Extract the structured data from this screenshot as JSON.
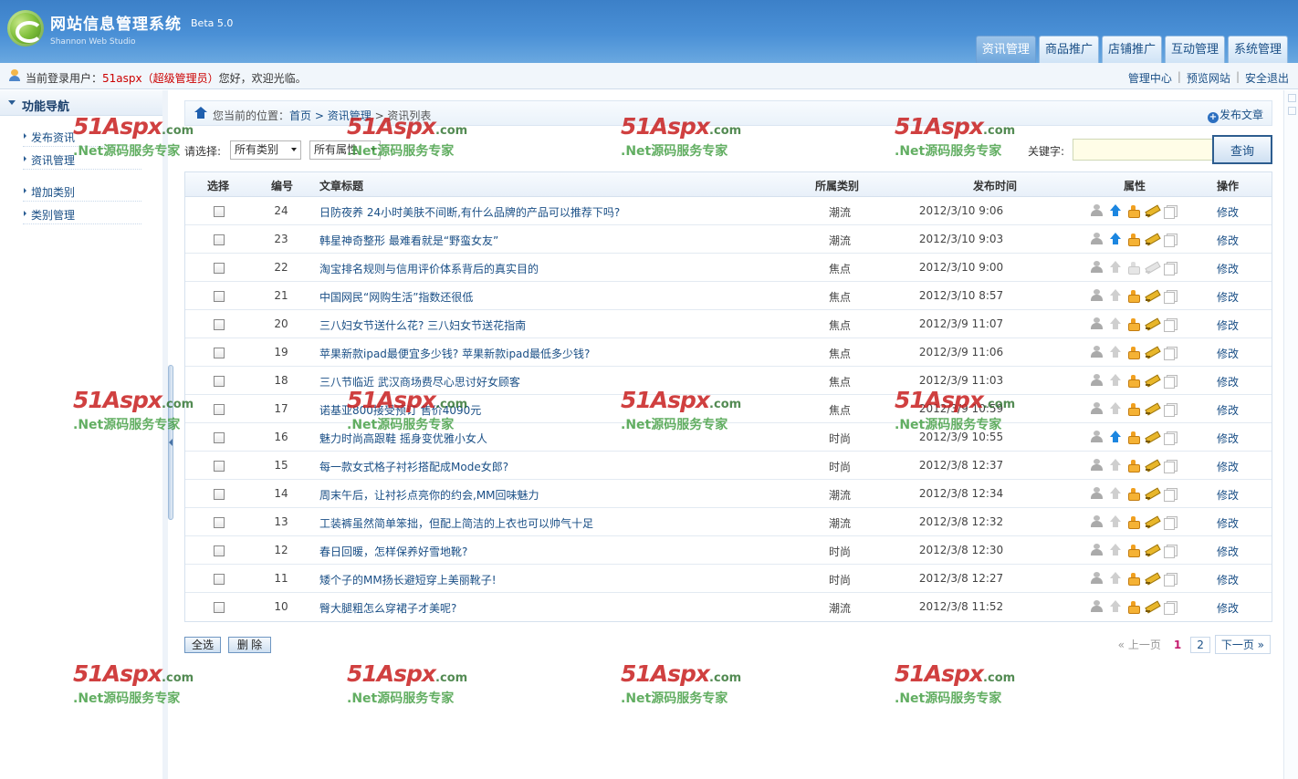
{
  "app": {
    "title": "网站信息管理系统",
    "beta": "Beta 5.0",
    "studio": "Shannon Web Studio"
  },
  "top_tabs": [
    {
      "label": "资讯管理",
      "active": true
    },
    {
      "label": "商品推广",
      "active": false
    },
    {
      "label": "店铺推广",
      "active": false
    },
    {
      "label": "互动管理",
      "active": false
    },
    {
      "label": "系统管理",
      "active": false
    }
  ],
  "userbar": {
    "prefix": "当前登录用户：",
    "username": "51aspx（超级管理员）",
    "welcome": "您好，欢迎光临。",
    "links": [
      "管理中心",
      "预览网站",
      "安全退出"
    ],
    "sep": "|"
  },
  "sidebar": {
    "title": "功能导航",
    "items": [
      "发布资讯",
      "资讯管理",
      "增加类别",
      "类别管理"
    ]
  },
  "breadcrumb": {
    "prefix": "您当前的位置：",
    "items": [
      "首页",
      "> 资讯管理",
      "> 资讯列表"
    ],
    "publish": "发布文章"
  },
  "filter": {
    "label": "请选择:",
    "category": "所有类别",
    "attribute": "所有属性",
    "keyword_label": "关键字:",
    "keyword_value": "",
    "search": "查询"
  },
  "table": {
    "headers": [
      "选择",
      "编号",
      "文章标题",
      "所属类别",
      "发布时间",
      "属性",
      "操作"
    ],
    "op_label": "修改",
    "rows": [
      {
        "id": "24",
        "title": "日防夜养 24小时美肤不间断,有什么品牌的产品可以推荐下吗?",
        "cat": "潮流",
        "time": "2012/3/10 9:06",
        "top": true,
        "thumb": true,
        "pen": true
      },
      {
        "id": "23",
        "title": "韩星神奇整形 最难看就是“野蛮女友”",
        "cat": "潮流",
        "time": "2012/3/10 9:03",
        "top": true,
        "thumb": true,
        "pen": true
      },
      {
        "id": "22",
        "title": "淘宝排名规则与信用评价体系背后的真实目的",
        "cat": "焦点",
        "time": "2012/3/10 9:00",
        "top": false,
        "thumb": false,
        "pen": false
      },
      {
        "id": "21",
        "title": "中国网民“网购生活”指数还很低",
        "cat": "焦点",
        "time": "2012/3/10 8:57",
        "top": false,
        "thumb": true,
        "pen": true
      },
      {
        "id": "20",
        "title": "三八妇女节送什么花? 三八妇女节送花指南",
        "cat": "焦点",
        "time": "2012/3/9 11:07",
        "top": false,
        "thumb": true,
        "pen": true
      },
      {
        "id": "19",
        "title": "苹果新款ipad最便宜多少钱? 苹果新款ipad最低多少钱?",
        "cat": "焦点",
        "time": "2012/3/9 11:06",
        "top": false,
        "thumb": true,
        "pen": true
      },
      {
        "id": "18",
        "title": "三八节临近 武汉商场费尽心思讨好女顾客",
        "cat": "焦点",
        "time": "2012/3/9 11:03",
        "top": false,
        "thumb": true,
        "pen": true
      },
      {
        "id": "17",
        "title": "诺基亚800接受预订 售价4090元",
        "cat": "焦点",
        "time": "2012/3/9 10:59",
        "top": false,
        "thumb": true,
        "pen": true
      },
      {
        "id": "16",
        "title": "魅力时尚高跟鞋 摇身变优雅小女人",
        "cat": "时尚",
        "time": "2012/3/9 10:55",
        "top": true,
        "thumb": true,
        "pen": true
      },
      {
        "id": "15",
        "title": "每一款女式格子衬衫搭配成Mode女郎?",
        "cat": "时尚",
        "time": "2012/3/8 12:37",
        "top": false,
        "thumb": true,
        "pen": true
      },
      {
        "id": "14",
        "title": "周末午后，让衬衫点亮你的约会,MM回味魅力",
        "cat": "潮流",
        "time": "2012/3/8 12:34",
        "top": false,
        "thumb": true,
        "pen": true
      },
      {
        "id": "13",
        "title": "工装裤虽然简单笨拙，但配上简洁的上衣也可以帅气十足",
        "cat": "潮流",
        "time": "2012/3/8 12:32",
        "top": false,
        "thumb": true,
        "pen": true
      },
      {
        "id": "12",
        "title": "春日回暖，怎样保养好雪地靴?",
        "cat": "时尚",
        "time": "2012/3/8 12:30",
        "top": false,
        "thumb": true,
        "pen": true
      },
      {
        "id": "11",
        "title": "矮个子的MM扬长避短穿上美丽靴子!",
        "cat": "时尚",
        "time": "2012/3/8 12:27",
        "top": false,
        "thumb": true,
        "pen": true
      },
      {
        "id": "10",
        "title": "臀大腿粗怎么穿裙子才美呢?",
        "cat": "潮流",
        "time": "2012/3/8 11:52",
        "top": false,
        "thumb": true,
        "pen": true
      }
    ]
  },
  "actions": {
    "select_all": "全选",
    "delete": "删 除"
  },
  "pager": {
    "prev": "« 上一页",
    "current": "1",
    "pages": [
      "2"
    ],
    "next": "下一页 »"
  },
  "watermark": {
    "brand": "51Aspx",
    "domain": ".com",
    "slogan": ".Net源码服务专家"
  }
}
